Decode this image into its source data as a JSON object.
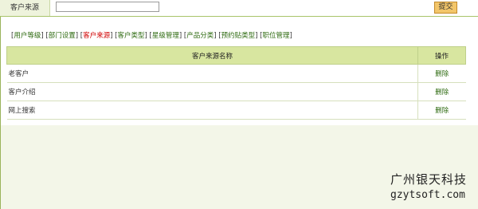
{
  "filter": {
    "label": "客户来源",
    "input_value": "",
    "submit_label": "提交"
  },
  "tabs": [
    {
      "label": "用户等级",
      "active": false
    },
    {
      "label": "部门设置",
      "active": false
    },
    {
      "label": "客户来源",
      "active": true
    },
    {
      "label": "客户类型",
      "active": false
    },
    {
      "label": "星级管理",
      "active": false
    },
    {
      "label": "产品分类",
      "active": false
    },
    {
      "label": "预约贴类型",
      "active": false
    },
    {
      "label": "职位管理",
      "active": false
    }
  ],
  "table": {
    "headers": {
      "name": "客户来源名称",
      "action": "操作"
    },
    "rows": [
      {
        "name": "老客户",
        "action": "删除"
      },
      {
        "name": "客户介绍",
        "action": "删除"
      },
      {
        "name": "网上搜索",
        "action": "删除"
      }
    ]
  },
  "watermark": {
    "company": "广州银天科技",
    "domain": "gzytsoft.com"
  },
  "colors": {
    "accent_green": "#2f6b12",
    "active_tab": "#d00000",
    "header_bg": "#d8e6a0",
    "button_bg": "#f3c66a"
  }
}
